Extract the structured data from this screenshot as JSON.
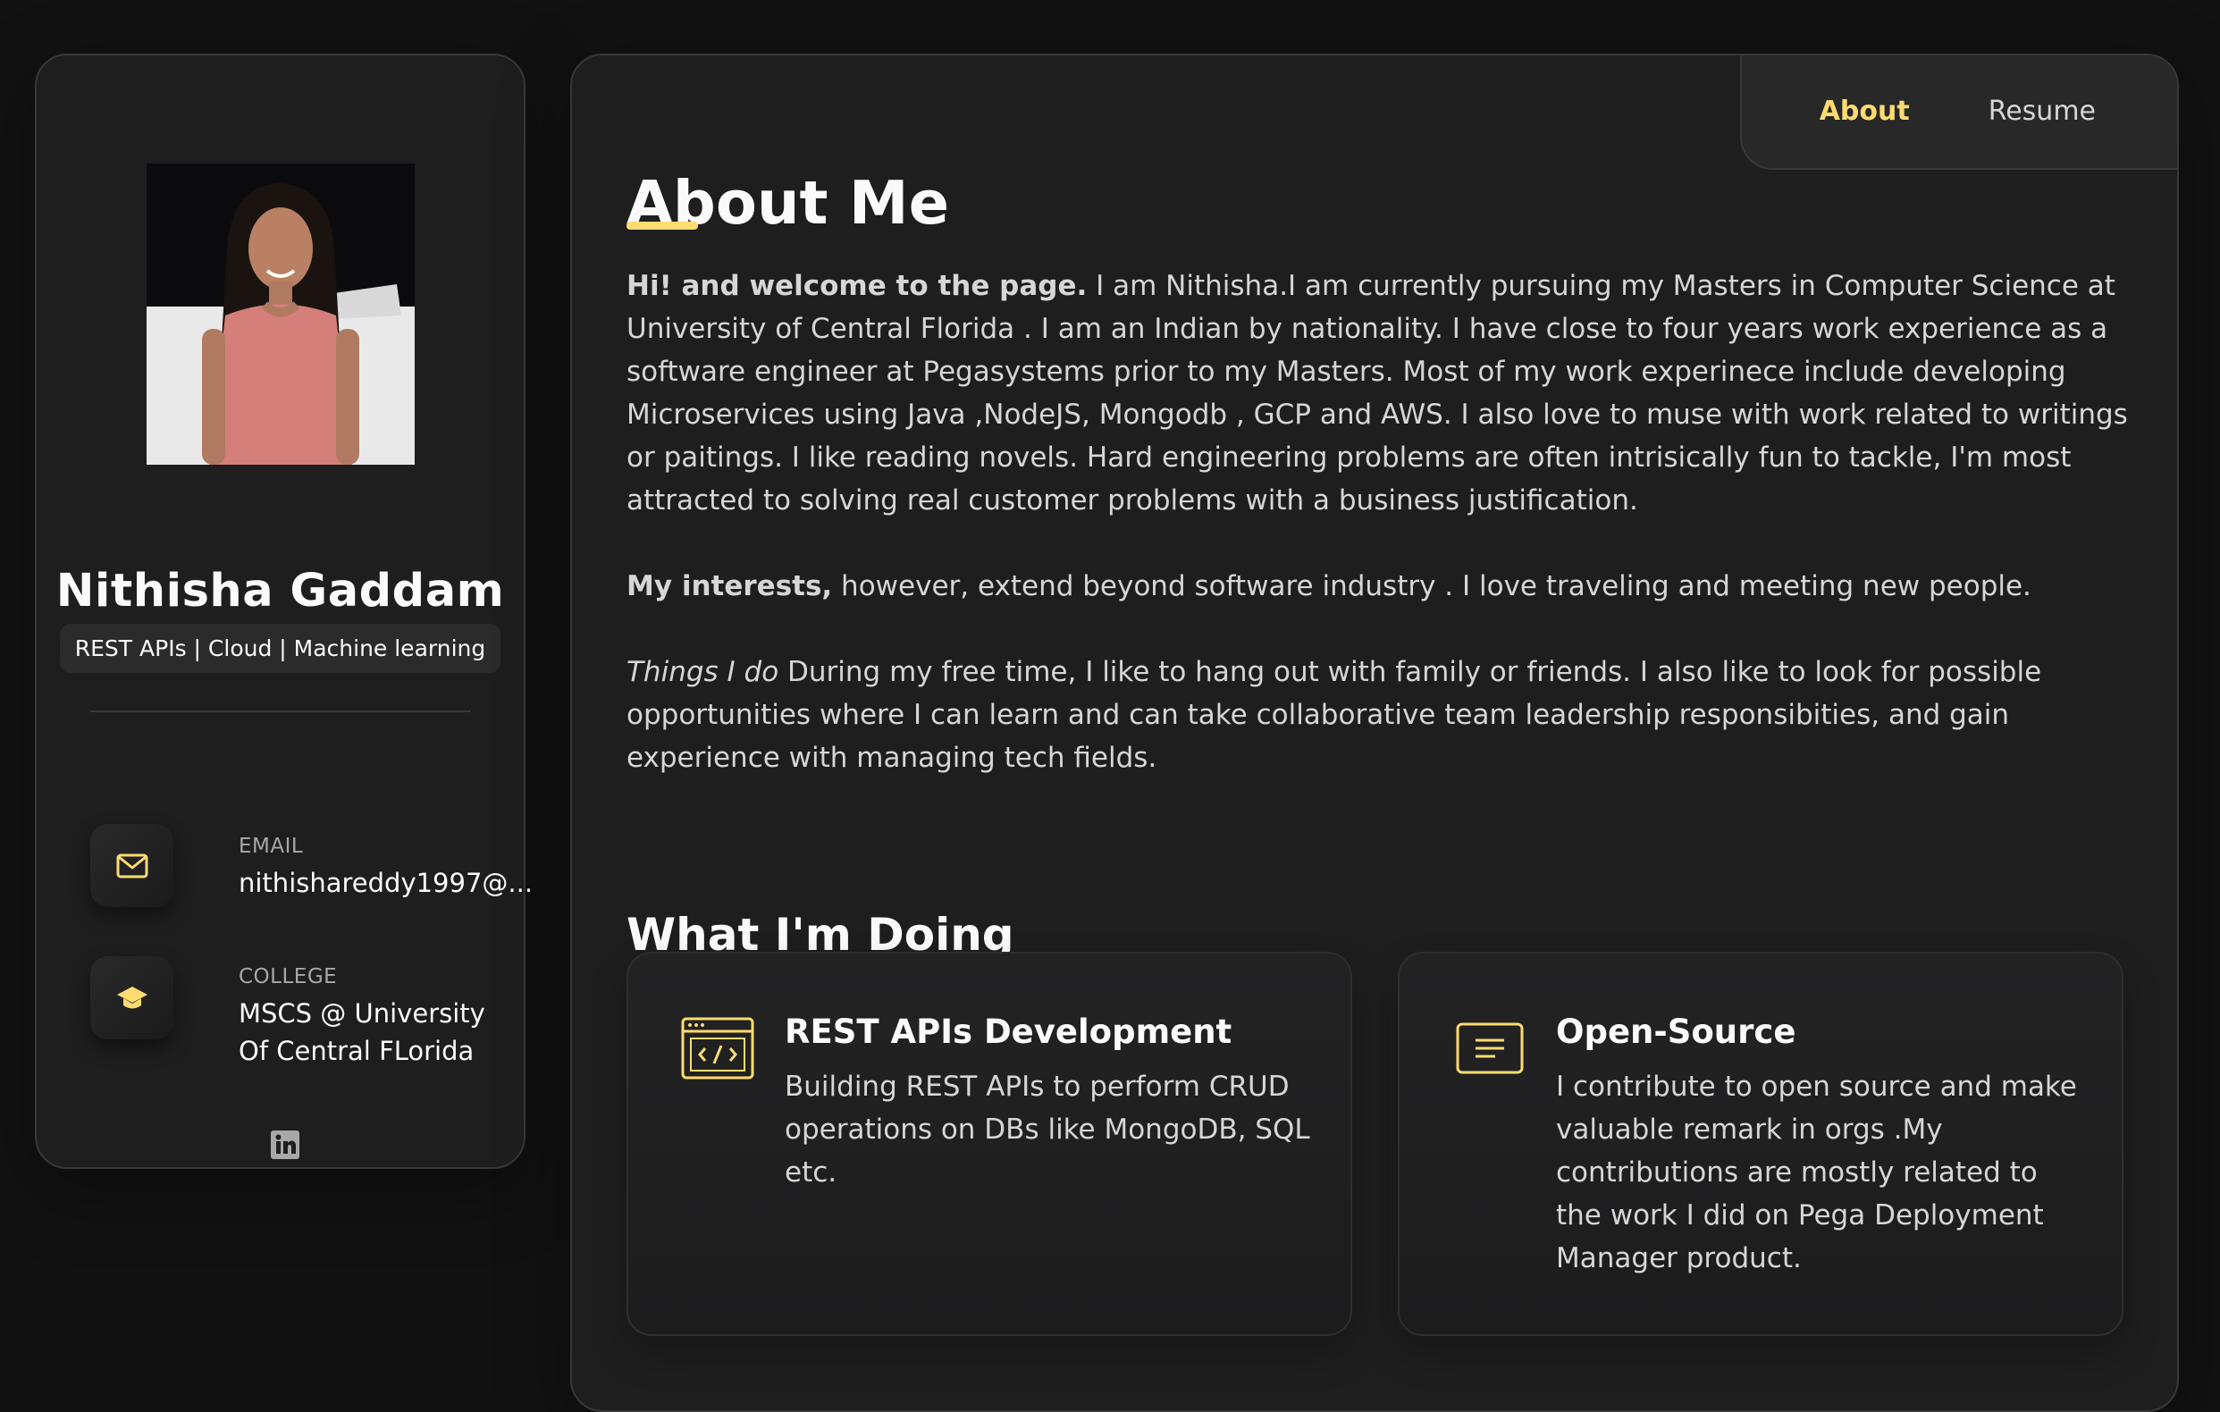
{
  "sidebar": {
    "name": "Nithisha Gaddam",
    "title": "REST APIs | Cloud | Machine learning",
    "contacts": [
      {
        "title": "EMAIL",
        "value": "nithishareddy1997@...",
        "icon": "mail-icon"
      },
      {
        "title": "COLLEGE",
        "value": "MSCS @ University Of Central FLorida",
        "icon": "graduation-cap-icon"
      }
    ],
    "social": [
      {
        "icon": "linkedin-icon"
      }
    ]
  },
  "navbar": {
    "items": [
      {
        "label": "About",
        "active": true
      },
      {
        "label": "Resume",
        "active": false
      }
    ]
  },
  "about": {
    "title": "About Me",
    "p1_bold": "Hi! and welcome to the page.",
    "p1_text": " I am Nithisha.I am currently pursuing my Masters in Computer Science at University of Central Florida . I am an Indian by nationality. I have close to four years work experience as a software engineer at Pegasystems prior to my Masters. Most of my work experinece include developing Microservices using Java ,NodeJS, Mongodb , GCP and AWS. I also love to muse with work related to writings or paitings. I like reading novels. Hard engineering problems are often intrisically fun to tackle, I'm most attracted to solving real customer problems with a business justification.",
    "p2_bold": "My interests,",
    "p2_text": " however, extend beyond software industry . I love traveling and meeting new people.",
    "p3_italic": "Things I do",
    "p3_text": " During my free time, I like to hang out with family or friends. I also like to look for possible opportunities where I can learn and can take collaborative team leadership responsibities, and gain experience with managing tech fields."
  },
  "services": {
    "title": "What I'm Doing",
    "items": [
      {
        "title": "REST APIs Development",
        "text": "Building REST APIs to perform CRUD operations on DBs like MongoDB, SQL etc.",
        "icon": "code-window-icon"
      },
      {
        "title": "Open-Source",
        "text": "I contribute to open source and make valuable remark in orgs .My contributions are mostly related to the work I did on Pega Deployment Manager product.",
        "icon": "document-lines-icon"
      }
    ]
  },
  "colors": {
    "accent": "#ffdb70",
    "background": "#121213",
    "card": "#1e1e1f",
    "text": "#d6d6d6",
    "heading": "#fafafa"
  }
}
